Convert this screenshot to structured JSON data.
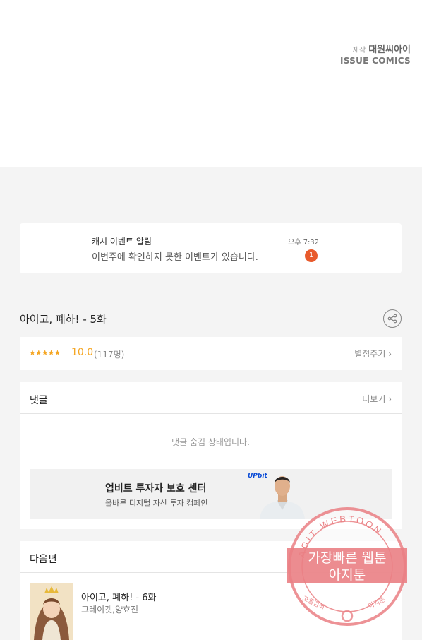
{
  "credits": {
    "label": "제작",
    "studio": "대원씨아이",
    "publisher": "ISSUE COMICS"
  },
  "notification": {
    "title": "캐시 이벤트 알림",
    "body": "이번주에 확인하지 못한 이벤트가 있습니다.",
    "time": "오후 7:32",
    "badge": "1"
  },
  "episode": {
    "title": "아이고, 폐하! - 5화",
    "stars": "★★★★★",
    "score": "10.0",
    "count": "(117명)",
    "rate_link": "별점주기 ›"
  },
  "comments": {
    "heading": "댓글",
    "more": "더보기 ›",
    "hidden_message": "댓글 숨김 상태입니다."
  },
  "ad": {
    "title": "업비트 투자자 보호 센터",
    "subtitle": "올바른 디지털 자산 투자 캠페인",
    "brand": "UPbit"
  },
  "next_episode": {
    "heading": "다음편",
    "title": "아이고, 폐하! - 6화",
    "author": "그레이캣,양효진"
  },
  "watermark": {
    "ring_text": "AGIT WEBTOON",
    "line1": "가장빠른 웹툰",
    "line2": "아지툰",
    "foot_left": "고퀄검색",
    "foot_right": "아지툰",
    "color": "#e8474b"
  }
}
